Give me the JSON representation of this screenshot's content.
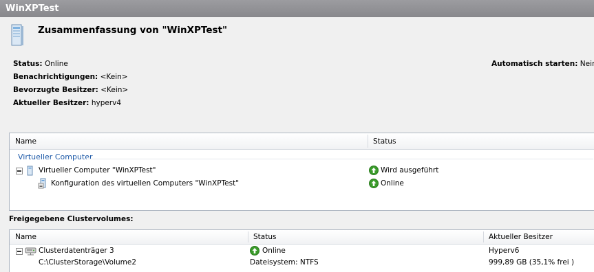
{
  "window": {
    "title": "WinXPTest"
  },
  "summary": {
    "title": "Zusammenfassung von \"WinXPTest\"",
    "status_label": "Status:",
    "status_value": "Online",
    "notifications_label": "Benachrichtigungen:",
    "notifications_value": "<Kein>",
    "preferred_owners_label": "Bevorzugte Besitzer:",
    "preferred_owners_value": "<Kein>",
    "current_owner_label": "Aktueller Besitzer:",
    "current_owner_value": "hyperv4",
    "autostart_label": "Automatisch starten:",
    "autostart_value": "Nein"
  },
  "resources": {
    "columns": [
      "Name",
      "Status"
    ],
    "group_header": "Virtueller Computer",
    "rows": [
      {
        "name": "Virtueller Computer \"WinXPTest\"",
        "status": "Wird ausgeführt",
        "icon": "virtual-machine-icon"
      },
      {
        "name": "Konfiguration des virtuellen Computers \"WinXPTest\"",
        "status": "Online",
        "icon": "vm-configuration-icon"
      }
    ]
  },
  "volumes": {
    "section_label": "Freigegebene Clustervolumes:",
    "columns": [
      "Name",
      "Status",
      "Aktueller Besitzer"
    ],
    "rows": [
      {
        "name": "Clusterdatenträger 3",
        "status": "Online",
        "owner": "Hyperv6",
        "path": "C:\\ClusterStorage\\Volume2",
        "filesystem": "Dateisystem: NTFS",
        "free": "999,89 GB (35,1% frei )"
      }
    ]
  },
  "colors": {
    "titlebar": "#949498",
    "group_header": "#1e5aa8",
    "ok_green": "#3a9b2a",
    "panel_border": "#aeb6c2"
  }
}
